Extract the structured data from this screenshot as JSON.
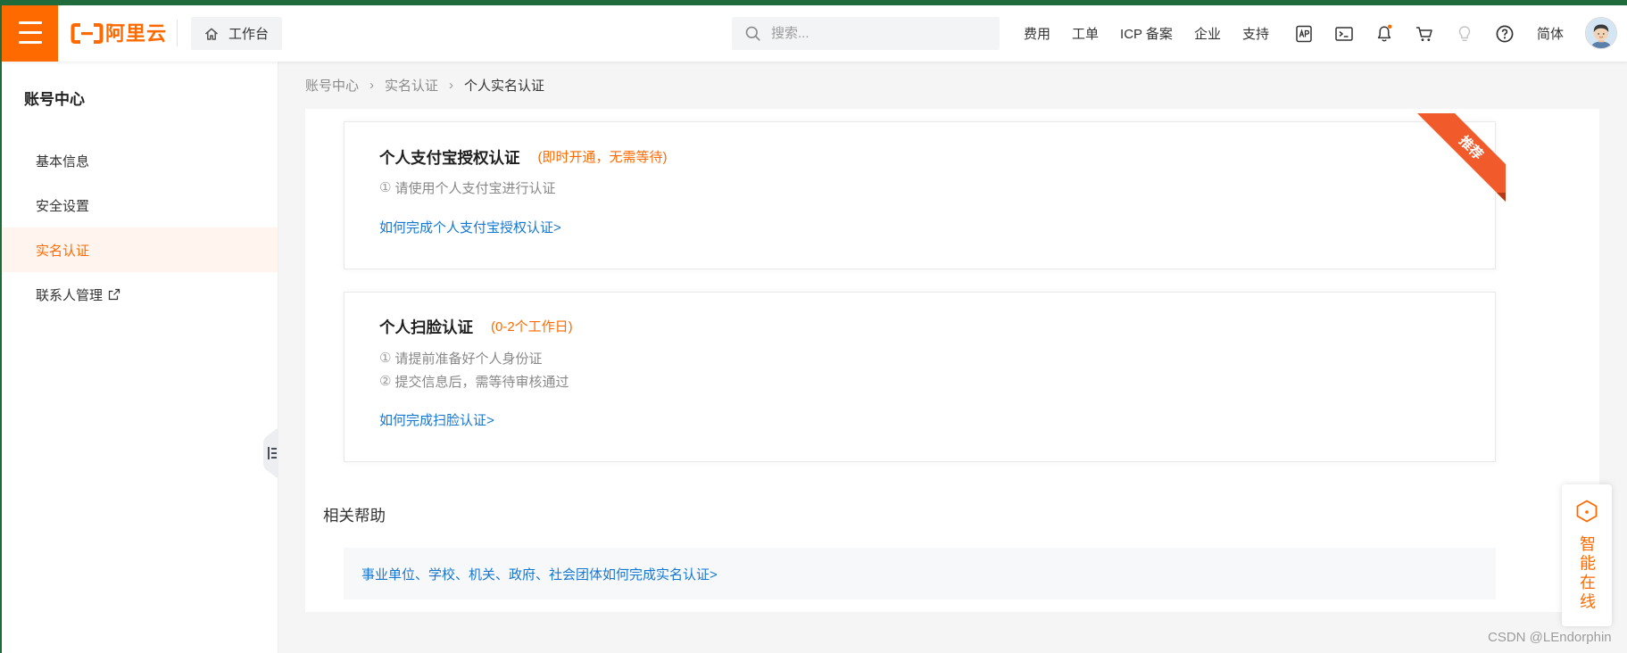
{
  "theme": {
    "accent": "#ff6a00",
    "link": "#1677d2",
    "ribbon": "#f15a2b",
    "ribbon_fold": "#b73a14",
    "frame": "#1f6b3b"
  },
  "header": {
    "logo_text": "阿里云",
    "workbench_label": "工作台",
    "search_placeholder": "搜索...",
    "nav": [
      "费用",
      "工单",
      "ICP 备案",
      "企业",
      "支持"
    ],
    "icons": [
      "api-icon",
      "terminal-icon",
      "bell-icon",
      "cart-icon",
      "bulb-icon",
      "help-icon"
    ],
    "notification_dot": true,
    "lang_label": "简体"
  },
  "sidebar": {
    "title": "账号中心",
    "items": [
      {
        "label": "基本信息",
        "active": false
      },
      {
        "label": "安全设置",
        "active": false
      },
      {
        "label": "实名认证",
        "active": true
      },
      {
        "label": "联系人管理",
        "active": false,
        "external": true
      }
    ]
  },
  "breadcrumb": {
    "items": [
      "账号中心",
      "实名认证",
      "个人实名认证"
    ],
    "separator": "›"
  },
  "cards": [
    {
      "title": "个人支付宝授权认证",
      "tag": "(即时开通，无需等待)",
      "badge": "推荐",
      "steps": [
        {
          "num": "①",
          "text": "请使用个人支付宝进行认证"
        }
      ],
      "link": "如何完成个人支付宝授权认证>"
    },
    {
      "title": "个人扫脸认证",
      "tag": "(0-2个工作日)",
      "steps": [
        {
          "num": "①",
          "text": "请提前准备好个人身份证"
        },
        {
          "num": "②",
          "text": "提交信息后，需等待审核通过"
        }
      ],
      "link": "如何完成扫脸认证>"
    }
  ],
  "related_help": {
    "title": "相关帮助",
    "links": [
      "事业单位、学校、机关、政府、社会团体如何完成实名认证>"
    ]
  },
  "chat_widget": {
    "label": "智能在线",
    "icon": "hexagon-icon"
  },
  "watermark": "CSDN @LEndorphin"
}
